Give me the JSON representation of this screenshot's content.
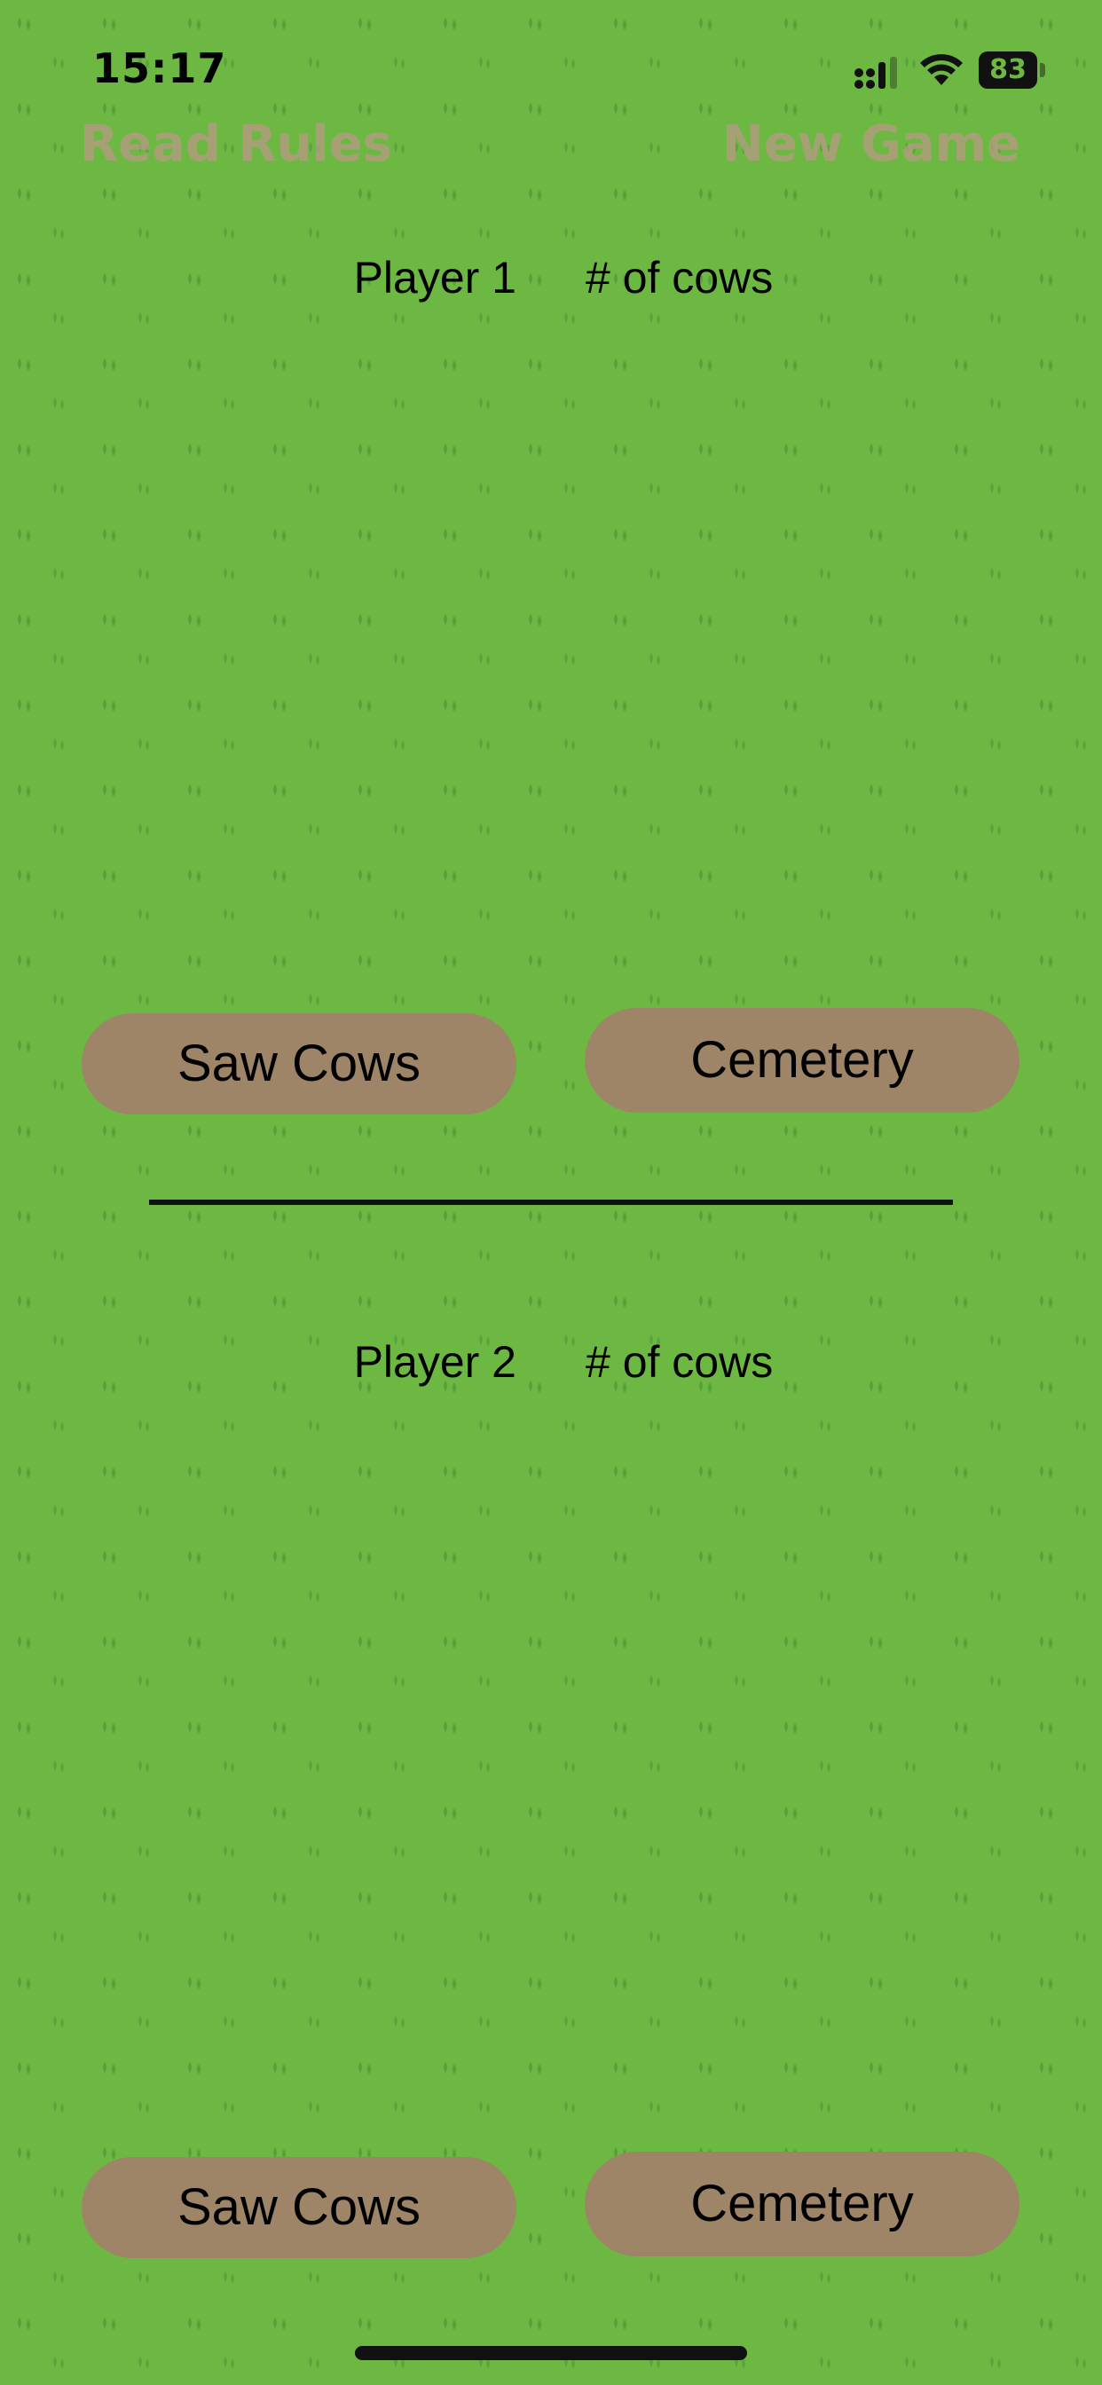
{
  "status_bar": {
    "time": "15:17",
    "battery_level": "83",
    "icons": [
      "signal-icon",
      "wifi-icon",
      "battery-icon"
    ]
  },
  "nav": {
    "read_rules": "Read Rules",
    "new_game": "New Game"
  },
  "players": [
    {
      "name": "Player 1",
      "count_label": "# of cows",
      "buttons": {
        "saw_cows": "Saw Cows",
        "cemetery": "Cemetery"
      }
    },
    {
      "name": "Player 2",
      "count_label": "# of cows",
      "buttons": {
        "saw_cows": "Saw Cows",
        "cemetery": "Cemetery"
      }
    }
  ],
  "colors": {
    "background": "#6db843",
    "button": "#9e8567",
    "nav_link": "#b89a86",
    "text": "#000000"
  }
}
